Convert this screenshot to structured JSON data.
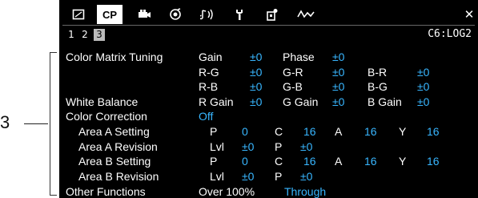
{
  "callout": "3",
  "tabs": [
    {
      "icon": "playback-frame-icon"
    },
    {
      "label": "CP",
      "active": true
    },
    {
      "icon": "camera-film-icon"
    },
    {
      "icon": "lens-dial-icon"
    },
    {
      "icon": "audio-icon"
    },
    {
      "icon": "wrench-icon"
    },
    {
      "icon": "custom-settings-icon"
    },
    {
      "icon": "waveform-icon"
    },
    {
      "close": "✕"
    }
  ],
  "pages": [
    "1",
    "2",
    "3"
  ],
  "preset": "C6:LOG2",
  "labels": {
    "color_matrix": "Color Matrix Tuning",
    "white_balance": "White Balance",
    "color_correction": "Color Correction",
    "area_a_setting": "Area A Setting",
    "area_a_revision": "Area A Revision",
    "area_b_setting": "Area B Setting",
    "area_b_revision": "Area B Revision",
    "other_functions": "Other Functions"
  },
  "matrix": {
    "gain": "Gain",
    "gain_v": "±0",
    "phase": "Phase",
    "phase_v": "±0",
    "rg": "R-G",
    "rg_v": "±0",
    "gr": "G-R",
    "gr_v": "±0",
    "br": "B-R",
    "br_v": "±0",
    "rb": "R-B",
    "rb_v": "±0",
    "gb": "G-B",
    "gb_v": "±0",
    "bg": "B-G",
    "bg_v": "±0"
  },
  "wb": {
    "rgain": "R Gain",
    "rgain_v": "±0",
    "ggain": "G Gain",
    "ggain_v": "±0",
    "bgain": "B Gain",
    "bgain_v": "±0"
  },
  "cc": {
    "value": "Off"
  },
  "area_a_setting": {
    "p": "P",
    "p_v": "0",
    "c": "C",
    "c_v": "16",
    "a": "A",
    "a_v": "16",
    "y": "Y",
    "y_v": "16"
  },
  "area_a_revision": {
    "lvl": "Lvl",
    "lvl_v": "±0",
    "p": "P",
    "p_v": "±0"
  },
  "area_b_setting": {
    "p": "P",
    "p_v": "0",
    "c": "C",
    "c_v": "16",
    "a": "A",
    "a_v": "16",
    "y": "Y",
    "y_v": "16"
  },
  "area_b_revision": {
    "lvl": "Lvl",
    "lvl_v": "±0",
    "p": "P",
    "p_v": "±0"
  },
  "other": {
    "name": "Over 100%",
    "value": "Through"
  }
}
